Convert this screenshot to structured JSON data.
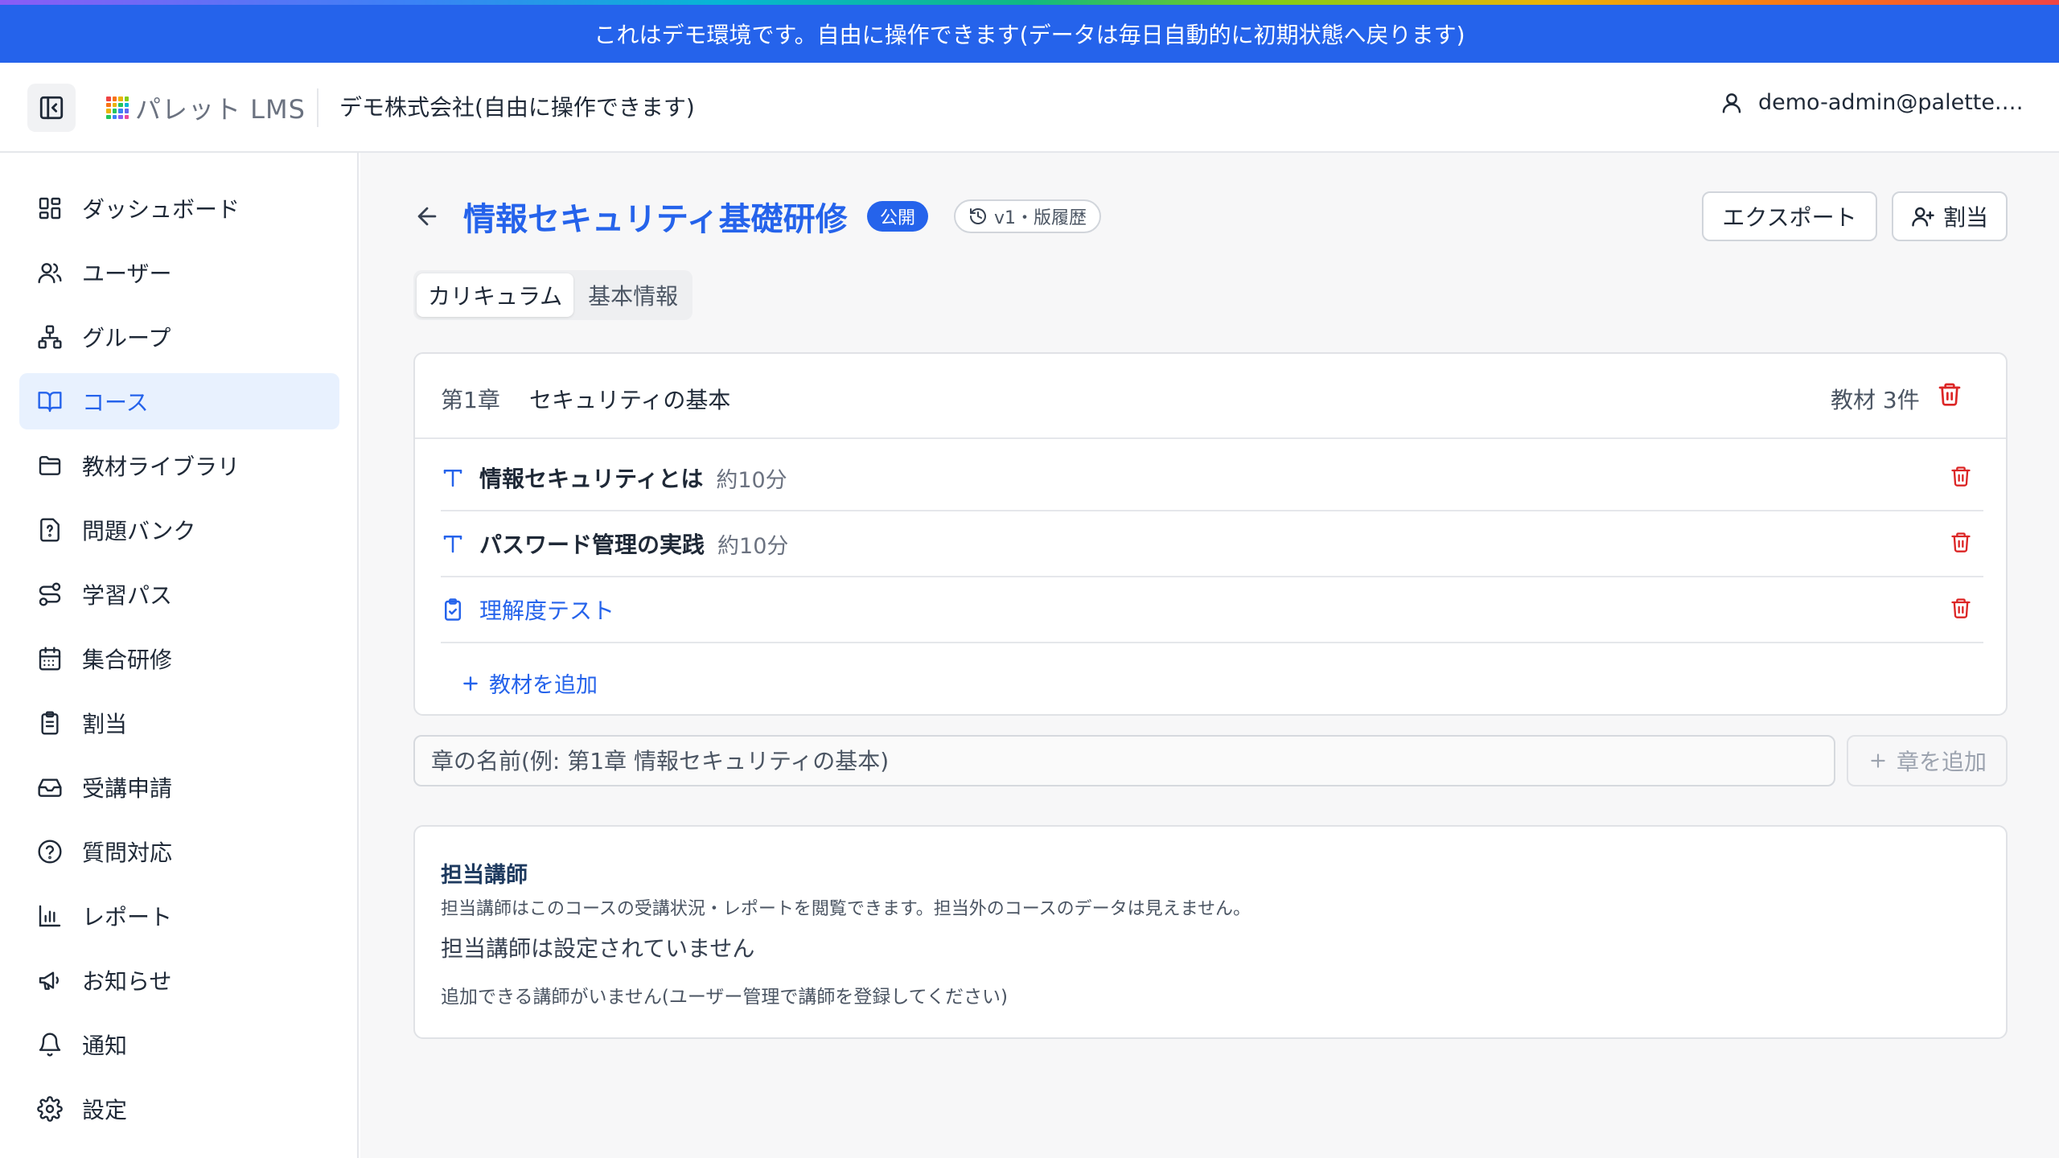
{
  "banner": {
    "text": "これはデモ環境です。自由に操作できます(データは毎日自動的に初期状態へ戻ります)"
  },
  "header": {
    "logo_text": "パレット LMS",
    "company": "デモ株式会社(自由に操作できます)",
    "user_email": "demo-admin@palette.example.com"
  },
  "sidebar": {
    "items": [
      {
        "label": "ダッシュボード",
        "icon": "dashboard-icon"
      },
      {
        "label": "ユーザー",
        "icon": "users-icon"
      },
      {
        "label": "グループ",
        "icon": "group-icon"
      },
      {
        "label": "コース",
        "icon": "book-icon",
        "active": true
      },
      {
        "label": "教材ライブラリ",
        "icon": "folder-icon"
      },
      {
        "label": "問題バンク",
        "icon": "question-file-icon"
      },
      {
        "label": "学習パス",
        "icon": "route-icon"
      },
      {
        "label": "集合研修",
        "icon": "calendar-icon"
      },
      {
        "label": "割当",
        "icon": "clipboard-icon"
      },
      {
        "label": "受講申請",
        "icon": "inbox-icon"
      },
      {
        "label": "質問対応",
        "icon": "help-circle-icon"
      },
      {
        "label": "レポート",
        "icon": "bar-chart-icon"
      },
      {
        "label": "お知らせ",
        "icon": "megaphone-icon"
      },
      {
        "label": "通知",
        "icon": "bell-icon"
      },
      {
        "label": "設定",
        "icon": "gear-icon"
      }
    ]
  },
  "course": {
    "title": "情報セキュリティ基礎研修",
    "status_badge": "公開",
    "version_label": "v1・版履歴",
    "export_label": "エクスポート",
    "assign_label": "割当"
  },
  "tabs": [
    {
      "label": "カリキュラム",
      "active": true
    },
    {
      "label": "基本情報",
      "active": false
    }
  ],
  "chapter": {
    "number": "第1章",
    "name": "セキュリティの基本",
    "count_label": "教材 3件",
    "materials": [
      {
        "title": "情報セキュリティとは",
        "duration": "約10分",
        "type": "text",
        "icon": "text-icon"
      },
      {
        "title": "パスワード管理の実践",
        "duration": "約10分",
        "type": "text",
        "icon": "text-icon"
      },
      {
        "title": "理解度テスト",
        "duration": "",
        "type": "test",
        "icon": "clipboard-check-icon"
      }
    ],
    "add_material_label": "教材を追加"
  },
  "add_chapter": {
    "placeholder": "章の名前(例: 第1章 情報セキュリティの基本)",
    "button_label": "章を追加"
  },
  "instructors": {
    "title": "担当講師",
    "description": "担当講師はこのコースの受講状況・レポートを閲覧できます。担当外のコースのデータは見えません。",
    "empty_text": "担当講師は設定されていません",
    "hint": "追加できる講師がいません(ユーザー管理で講師を登録してください)"
  },
  "colors": {
    "accent": "#2563eb",
    "danger": "#dc2626",
    "active_bg": "#e8f1fe"
  }
}
